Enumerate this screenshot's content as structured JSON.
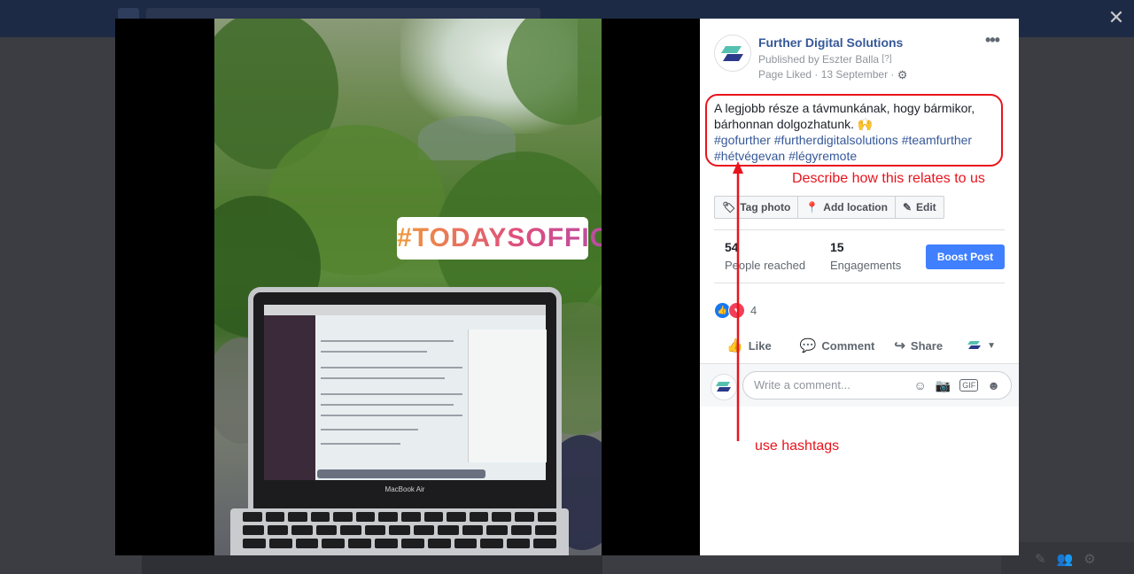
{
  "viewer": {
    "close_label": "✕"
  },
  "photo": {
    "sticker_text": "#TODAYSOFFICE",
    "laptop_label": "MacBook Air"
  },
  "post": {
    "page_name": "Further Digital Solutions",
    "published_by": "Published by Eszter Balla",
    "published_help": "[?]",
    "meta": "Page Liked · 13 September ·",
    "more_label": "•••",
    "body_line1": "A legjobb része a távmunkának, hogy bármikor, bárhonnan dolgozhatunk. 🙌",
    "hashtags": [
      "#gofurther",
      "#furtherdigitalsolutions",
      "#teamfurther",
      "#hétvégevan",
      "#légyremote"
    ],
    "actions": {
      "tag_photo": "Tag photo",
      "add_location": "Add location",
      "edit": "Edit"
    },
    "stats": {
      "reached_count": "54",
      "reached_label": "People reached",
      "engagements_count": "15",
      "engagements_label": "Engagements",
      "boost_label": "Boost Post"
    },
    "reactions": {
      "count": "4"
    },
    "action_bar": {
      "like": "Like",
      "comment": "Comment",
      "share": "Share"
    },
    "comment_placeholder": "Write a comment..."
  },
  "annotations": {
    "describe": "Describe how this relates to us",
    "hashtags": "use hashtags",
    "color": "#e8141c"
  },
  "colors": {
    "link": "#365899",
    "boost": "#4080ff",
    "like": "#1877f2",
    "love": "#f33e58"
  }
}
